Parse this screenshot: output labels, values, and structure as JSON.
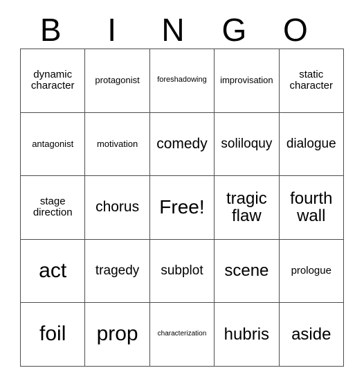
{
  "card": {
    "title": "BINGO",
    "header_letters": [
      "B",
      "I",
      "N",
      "G",
      "O"
    ],
    "free_space_label": "Free!",
    "colors": {
      "border": "#4d4d4d",
      "text": "#000000",
      "background": "#ffffff"
    },
    "rows": [
      [
        {
          "text": "dynamic character",
          "size": "md"
        },
        {
          "text": "protagonist",
          "size": "smd"
        },
        {
          "text": "foreshadowing",
          "size": "sm"
        },
        {
          "text": "improvisation",
          "size": "smd"
        },
        {
          "text": "static character",
          "size": "md"
        }
      ],
      [
        {
          "text": "antagonist",
          "size": "smd"
        },
        {
          "text": "motivation",
          "size": "smd"
        },
        {
          "text": "comedy",
          "size": "xl"
        },
        {
          "text": "soliloquy",
          "size": "lg"
        },
        {
          "text": "dialogue",
          "size": "lg"
        }
      ],
      [
        {
          "text": "stage direction",
          "size": "md"
        },
        {
          "text": "chorus",
          "size": "xl"
        },
        {
          "text": "Free!",
          "size": "huge"
        },
        {
          "text": "tragic flaw",
          "size": "xxl"
        },
        {
          "text": "fourth wall",
          "size": "xxl"
        }
      ],
      [
        {
          "text": "act",
          "size": "max"
        },
        {
          "text": "tragedy",
          "size": "lg"
        },
        {
          "text": "subplot",
          "size": "lg"
        },
        {
          "text": "scene",
          "size": "xxl"
        },
        {
          "text": "prologue",
          "size": "md"
        }
      ],
      [
        {
          "text": "foil",
          "size": "max"
        },
        {
          "text": "prop",
          "size": "max"
        },
        {
          "text": "characterization",
          "size": "xs"
        },
        {
          "text": "hubris",
          "size": "xxl"
        },
        {
          "text": "aside",
          "size": "xxl"
        }
      ]
    ]
  }
}
